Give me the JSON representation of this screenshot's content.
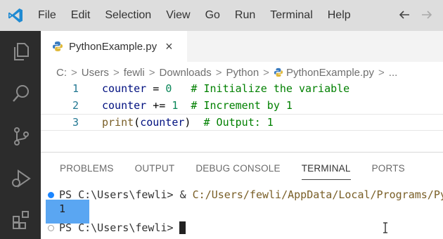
{
  "menubar": {
    "items": [
      "File",
      "Edit",
      "Selection",
      "View",
      "Go",
      "Run",
      "Terminal",
      "Help"
    ]
  },
  "activity_bar": {
    "icons": [
      "files-icon",
      "search-icon",
      "source-control-icon",
      "run-debug-icon",
      "extensions-icon"
    ]
  },
  "editor": {
    "tab": {
      "label": "PythonExample.py",
      "close": "×"
    },
    "breadcrumb": [
      "C:",
      "Users",
      "fewli",
      "Downloads",
      "Python",
      "PythonExample.py",
      "..."
    ],
    "lines": [
      {
        "number": "1",
        "tokens": [
          {
            "t": "counter",
            "c": "var"
          },
          {
            "t": " = ",
            "c": "op"
          },
          {
            "t": "0",
            "c": "num"
          },
          {
            "t": "   # Initialize the variable",
            "c": "cmt"
          }
        ]
      },
      {
        "number": "2",
        "tokens": [
          {
            "t": "counter",
            "c": "var"
          },
          {
            "t": " += ",
            "c": "op"
          },
          {
            "t": "1",
            "c": "num"
          },
          {
            "t": "  # Increment by 1",
            "c": "cmt"
          }
        ]
      },
      {
        "number": "3",
        "tokens": [
          {
            "t": "print",
            "c": "fn"
          },
          {
            "t": "(",
            "c": "op"
          },
          {
            "t": "counter",
            "c": "var"
          },
          {
            "t": ")",
            "c": "op"
          },
          {
            "t": "  # Output: 1",
            "c": "cmt"
          }
        ]
      }
    ]
  },
  "panel": {
    "tabs": [
      "PROBLEMS",
      "OUTPUT",
      "DEBUG CONSOLE",
      "TERMINAL",
      "PORTS"
    ],
    "active_tab": "TERMINAL"
  },
  "terminal": {
    "line1_prompt": "PS C:\\Users\\fewli> & ",
    "line1_path": "C:/Users/fewli/AppData/Local/Programs/Py",
    "output": "1",
    "line3_prompt": "PS C:\\Users\\fewli>"
  },
  "colors": {
    "menubar_bg": "#dddddd",
    "activitybar_bg": "#2c2c2c",
    "accent": "#1a85ff",
    "output_highlight": "#5aa6f2"
  }
}
